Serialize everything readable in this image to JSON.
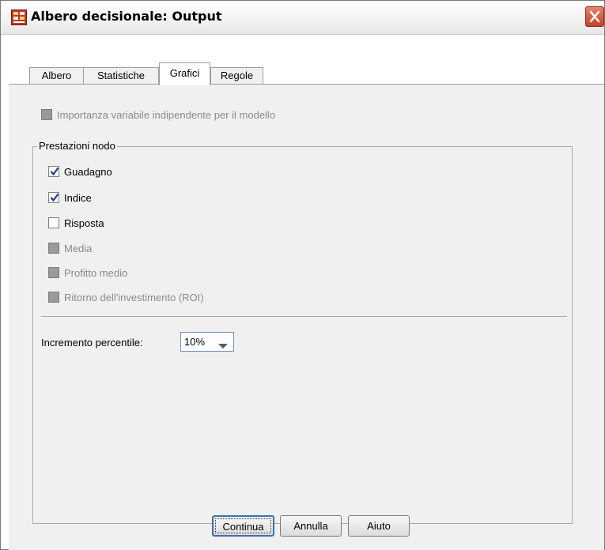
{
  "window": {
    "title": "Albero decisionale: Output",
    "icons": {
      "app": "tree-grid-icon",
      "close": "close-icon"
    },
    "colors": {
      "close_button": "#c4412a",
      "tab_border": "#9e9e9e",
      "panel_bg": "#f0f0f0"
    }
  },
  "tabs": [
    {
      "label": "Albero",
      "active": false
    },
    {
      "label": "Statistiche",
      "active": false
    },
    {
      "label": "Grafici",
      "active": true
    },
    {
      "label": "Regole",
      "active": false
    }
  ],
  "importanza": {
    "label": "Importanza variabile indipendente per il modello",
    "checked": false,
    "enabled": false
  },
  "prestazioni": {
    "legend": "Prestazioni nodo",
    "items": [
      {
        "label": "Guadagno",
        "checked": true,
        "enabled": true
      },
      {
        "label": "Indice",
        "checked": true,
        "enabled": true
      },
      {
        "label": "Risposta",
        "checked": false,
        "enabled": true
      },
      {
        "label": "Media",
        "checked": false,
        "enabled": false
      },
      {
        "label": "Profitto medio",
        "checked": false,
        "enabled": false
      },
      {
        "label": "Ritorno dell'investimento (ROI)",
        "checked": false,
        "enabled": false
      }
    ],
    "incremento_label": "Incremento percentile:",
    "incremento_value": "10%"
  },
  "buttons": {
    "continua": "Continua",
    "annulla": "Annulla",
    "aiuto": "Aiuto"
  }
}
